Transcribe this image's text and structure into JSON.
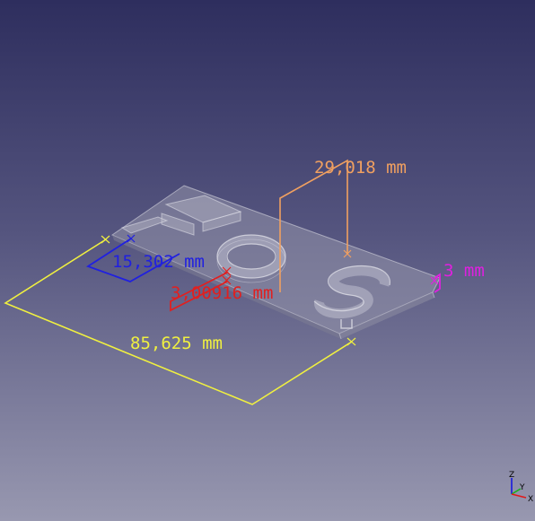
{
  "dimensions": {
    "length": {
      "label": "85,625 mm",
      "color": "#f0f040"
    },
    "height": {
      "label": "29,018 mm",
      "color": "#f0a060"
    },
    "letter_width": {
      "label": "15,302 mm",
      "color": "#2020e0"
    },
    "depth": {
      "label": "3,00916 mm",
      "color": "#e02020"
    },
    "thickness": {
      "label": "3 mm",
      "color": "#e020e0"
    }
  },
  "axes": {
    "z": "Z",
    "y": "Y",
    "x": "X"
  },
  "colors": {
    "background_top": "#2e2e5e",
    "background_bottom": "#9898b0"
  }
}
